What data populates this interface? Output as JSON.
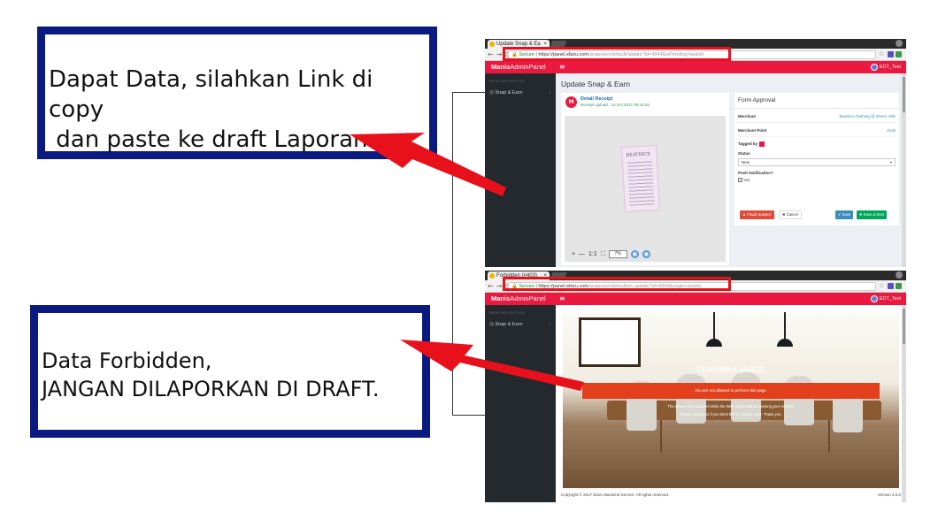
{
  "callouts": {
    "top": {
      "line1": "Dapat Data, silahkan Link di copy",
      "line2": " dan paste ke draft Laporan."
    },
    "bottom": {
      "line1": "Data Forbidden,",
      "line2": "JANGAN DILAPORKAN DI DRAFT."
    }
  },
  "colors": {
    "callout_border": "#0a1a80",
    "highlight_red": "#e8111b",
    "brand_red": "#e9193f",
    "sidebar": "#24292e"
  },
  "browser_top": {
    "tab_title": "Update Snap & Ea",
    "url": {
      "secure": "Secure",
      "host": "https://panel.ebizu.com",
      "path": "/snapearn/default/update?id=4944&isPending=asalist"
    },
    "brand_bold": "Manis",
    "brand_rest": "AdminPanel",
    "user": "EDT_Test",
    "sidebar_heading": "MAIN NAVIGATION",
    "sidebar_item": "Snap & Earn",
    "page_title": "Update Snap & Earn",
    "receipt": {
      "title": "Detail Receipt",
      "uploaded": "Receipt Upload : 18 Oct 2017 09:43:25",
      "store_name": "BEATRICE"
    },
    "viewer": {
      "zoom_in": "+",
      "zoom_out": "—",
      "actual_size": "1:1",
      "zoom": "7%"
    },
    "form": {
      "title": "Form Approval",
      "merchant_label": "Merchant",
      "merchant_value": "Beatrice Clothing @ Green Ville",
      "merchant_point_label": "Merchant Point",
      "merchant_point_value": "1518",
      "tagged_by_label": "Tagged by",
      "status_label": "Status",
      "status_value": "New",
      "push_label": "Push Notification?",
      "push_option": "Yes",
      "fraud_button": "▲ Fraud Suspect",
      "cancel_button": "✖ Cancel",
      "save_button": "✔ Save",
      "save_next_button": "✚ Save & Next"
    }
  },
  "browser_bottom": {
    "tab_title": "Forbidden (#403)",
    "url": {
      "secure": "Secure",
      "host": "https://panel.ebizu.com",
      "path": "/snapearn/default/sn-update?id=4944&origin=asalist"
    },
    "brand_bold": "Manis",
    "brand_rest": "AdminPanel",
    "user": "EDT_Test",
    "sidebar_heading": "MAIN NAVIGATION",
    "sidebar_item": "Snap & Earn",
    "error_title": "Forbidden (#403)",
    "error_message": "You are not allowed to perform this page.",
    "note_1": "The above error occurred while the Web server was processing your request.",
    "note_2": "Please contact us if you think this is a server error. Thank you.",
    "footer_copyright": "Copyright © 2017 Ebizu Backend Service. All rights reserved.",
    "footer_version": "Version 2.6.0"
  }
}
